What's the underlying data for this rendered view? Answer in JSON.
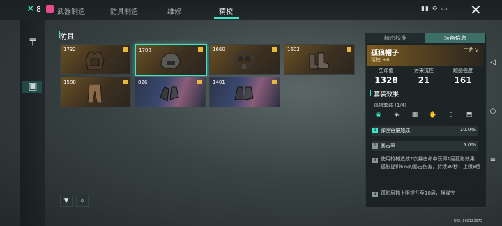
{
  "header": {
    "logo_glyph": "✕",
    "count": "8",
    "tabs": [
      {
        "label": "武器制造",
        "active": false
      },
      {
        "label": "防具制造",
        "active": false
      },
      {
        "label": "维修",
        "active": false
      },
      {
        "label": "精校",
        "active": true
      }
    ],
    "status_text": "▮▮ ⚙ ▭",
    "close_glyph": "✕"
  },
  "left_rail": [
    {
      "icon": "pistol-icon",
      "glyph": "╤"
    },
    {
      "icon": "armor-vest-icon",
      "glyph": "▣"
    }
  ],
  "section_title": "防具",
  "cards": [
    {
      "score": "1732",
      "kind": "vest"
    },
    {
      "score": "1708",
      "kind": "helmet",
      "selected": true
    },
    {
      "score": "1660",
      "kind": "mask"
    },
    {
      "score": "1602",
      "kind": "boots"
    },
    {
      "score": "1588",
      "kind": "pants"
    },
    {
      "score": "826",
      "kind": "gloves",
      "rare": true
    },
    {
      "score": "1401",
      "kind": "gloves",
      "rare": true
    }
  ],
  "panel": {
    "tabs": [
      "精密校准",
      "装备信息"
    ],
    "item_name": "孤狼帽子",
    "item_refine": "精校 +6",
    "craft_tag": "工艺 V",
    "stats": [
      {
        "label": "生命值",
        "value": "1328"
      },
      {
        "label": "污染抗性",
        "value": "21"
      },
      {
        "label": "超感强度",
        "value": "161"
      }
    ],
    "set_title": "套装效果",
    "set_name": "孤狼套装 (1/4)",
    "set_slots": [
      {
        "icon": "helmet-slot-icon",
        "glyph": "◉",
        "on": true
      },
      {
        "icon": "mask-slot-icon",
        "glyph": "◈",
        "on": false
      },
      {
        "icon": "vest-slot-icon",
        "glyph": "▦",
        "on": false
      },
      {
        "icon": "gloves-slot-icon",
        "glyph": "✋",
        "on": false
      },
      {
        "icon": "pants-slot-icon",
        "glyph": "▯",
        "on": false
      },
      {
        "icon": "boots-slot-icon",
        "glyph": "⬒",
        "on": false
      }
    ],
    "effects": [
      {
        "num": "1",
        "text": "弹匣容量加成",
        "value": "10.0%"
      },
      {
        "num": "2",
        "text": "暴击率",
        "value": "5.0%"
      }
    ],
    "effect3_num": "3",
    "effect3_text": "使用枪械造成2次暴击命中获得1层孤影效果，孤影提供6%的暴击伤害，持续30秒，上限8层",
    "effect4_num": "4",
    "effect4_text": "孤影层数上限提升至10层，换弹完"
  },
  "bottom_buttons": [
    {
      "icon": "filter-icon",
      "glyph": "▼"
    },
    {
      "icon": "search-icon",
      "glyph": "⌕"
    }
  ],
  "uid": "UID: 160123073",
  "sys_nav": [
    {
      "icon": "back-icon",
      "glyph": "◁"
    },
    {
      "icon": "home-icon",
      "glyph": "○"
    },
    {
      "icon": "menu-icon",
      "glyph": "≡"
    }
  ],
  "colors": {
    "accent": "#3ee6c8",
    "gold": "#e8b83a",
    "rare": "#5a6ea0"
  }
}
